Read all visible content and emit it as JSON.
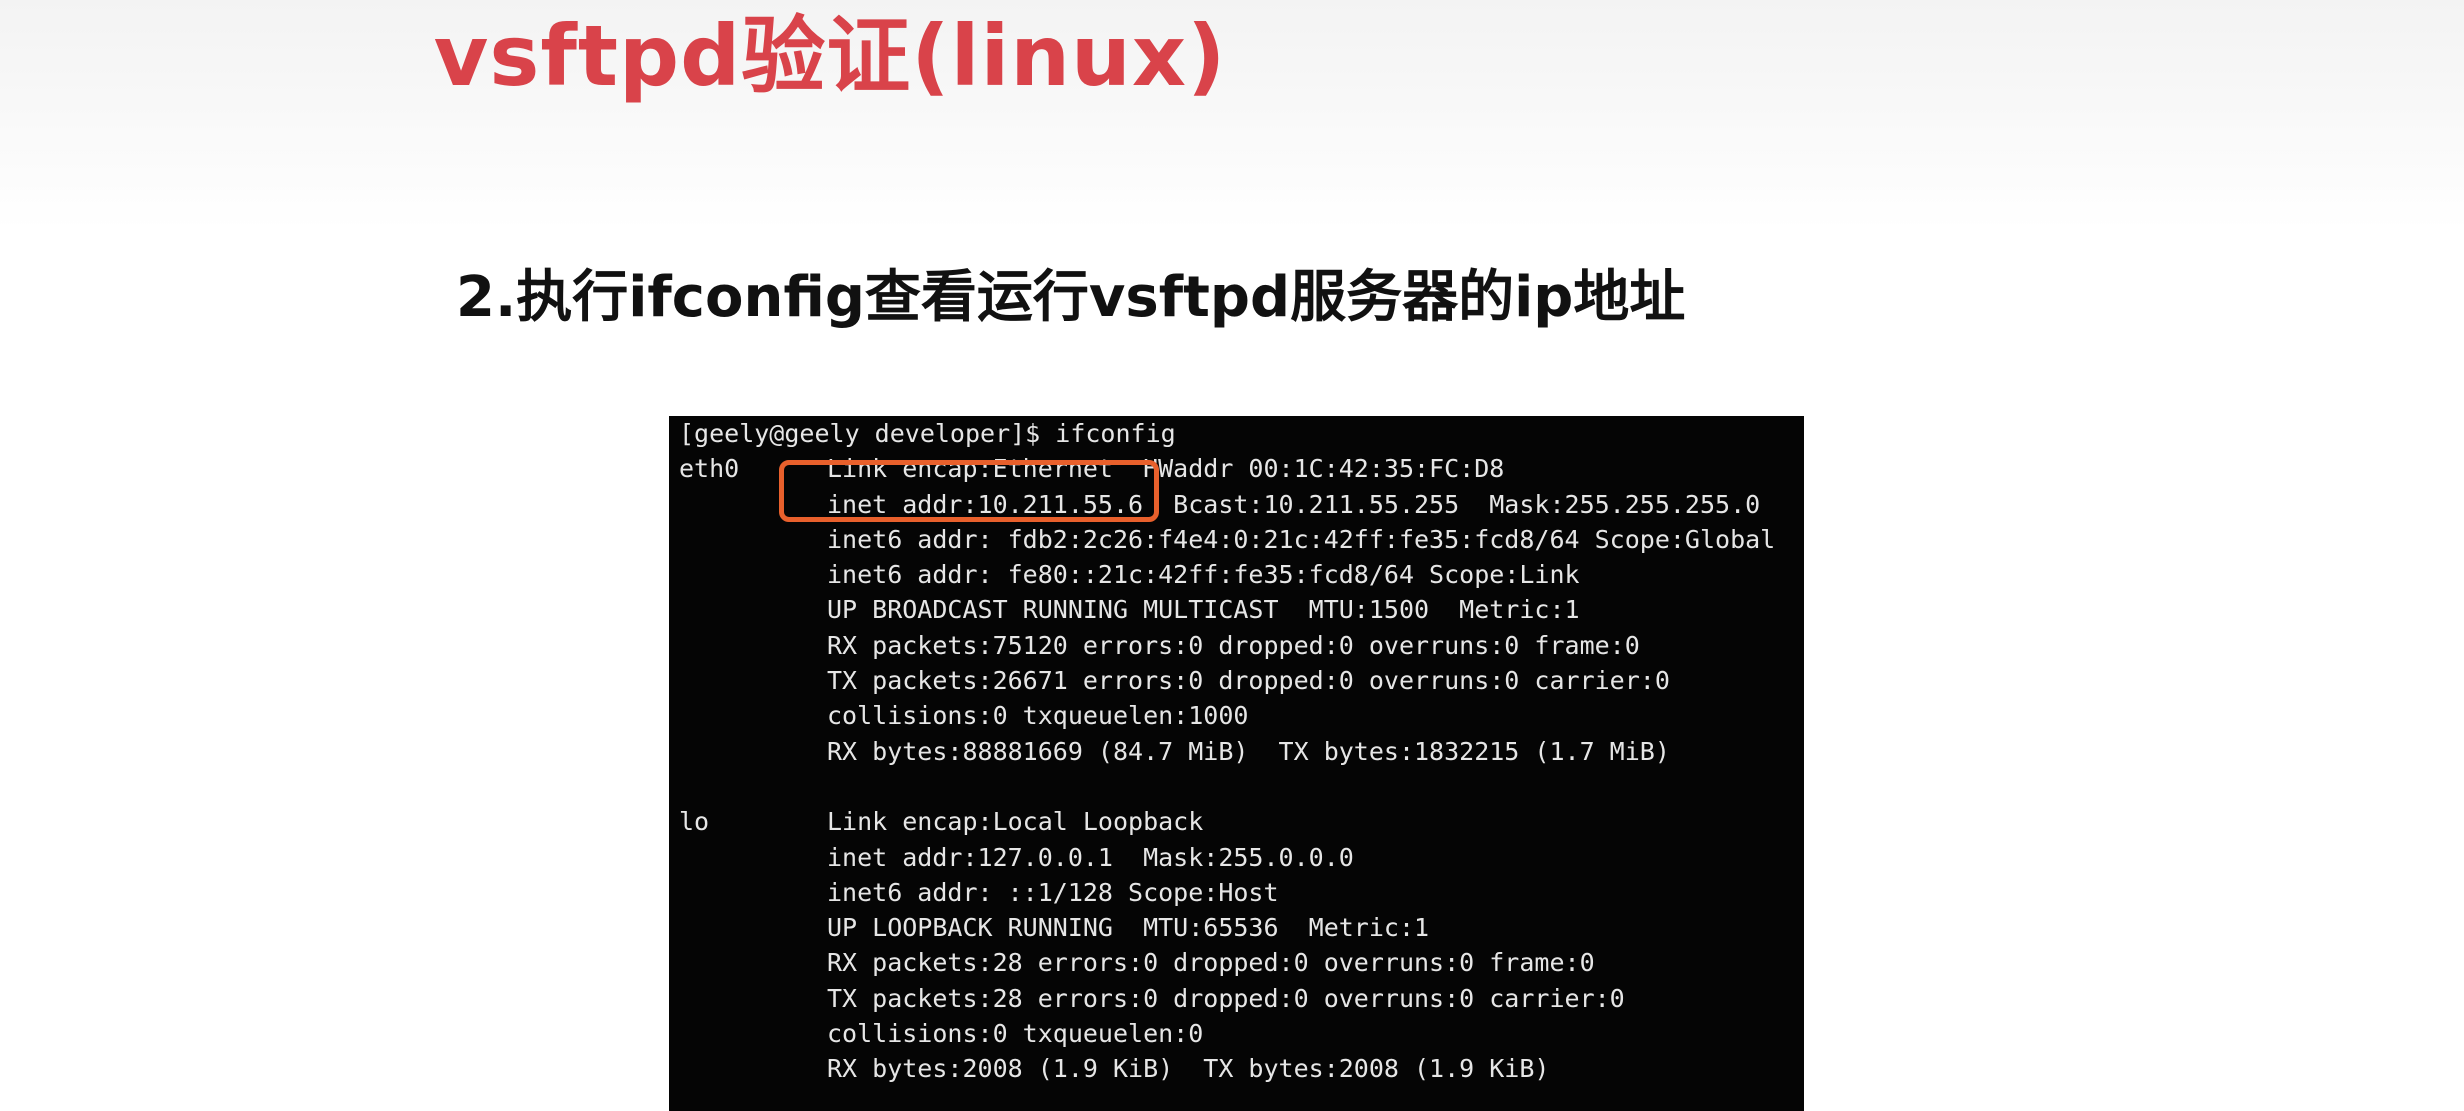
{
  "slide": {
    "title": "vsftpd验证(linux)",
    "subtitle": "2.执行ifconfig查看运行vsftpd服务器的ip地址"
  },
  "terminal": {
    "prompt_line": "[geely@geely developer]$ ifconfig",
    "eth0": {
      "name": "eth0",
      "lines": [
        "Link encap:Ethernet  HWaddr 00:1C:42:35:FC:D8",
        "inet addr:10.211.55.6  Bcast:10.211.55.255  Mask:255.255.255.0",
        "inet6 addr: fdb2:2c26:f4e4:0:21c:42ff:fe35:fcd8/64 Scope:Global",
        "inet6 addr: fe80::21c:42ff:fe35:fcd8/64 Scope:Link",
        "UP BROADCAST RUNNING MULTICAST  MTU:1500  Metric:1",
        "RX packets:75120 errors:0 dropped:0 overruns:0 frame:0",
        "TX packets:26671 errors:0 dropped:0 overruns:0 carrier:0",
        "collisions:0 txqueuelen:1000",
        "RX bytes:88881669 (84.7 MiB)  TX bytes:1832215 (1.7 MiB)"
      ]
    },
    "lo": {
      "name": "lo",
      "lines": [
        "Link encap:Local Loopback",
        "inet addr:127.0.0.1  Mask:255.0.0.0",
        "inet6 addr: ::1/128 Scope:Host",
        "UP LOOPBACK RUNNING  MTU:65536  Metric:1",
        "RX packets:28 errors:0 dropped:0 overruns:0 frame:0",
        "TX packets:28 errors:0 dropped:0 overruns:0 carrier:0",
        "collisions:0 txqueuelen:0",
        "RX bytes:2008 (1.9 KiB)  TX bytes:2008 (1.9 KiB)"
      ]
    }
  },
  "colors": {
    "title": "#d9434a",
    "subtitle": "#111111",
    "terminal_bg": "#050505",
    "terminal_text": "#e6e6e6",
    "highlight": "#e8602c"
  }
}
